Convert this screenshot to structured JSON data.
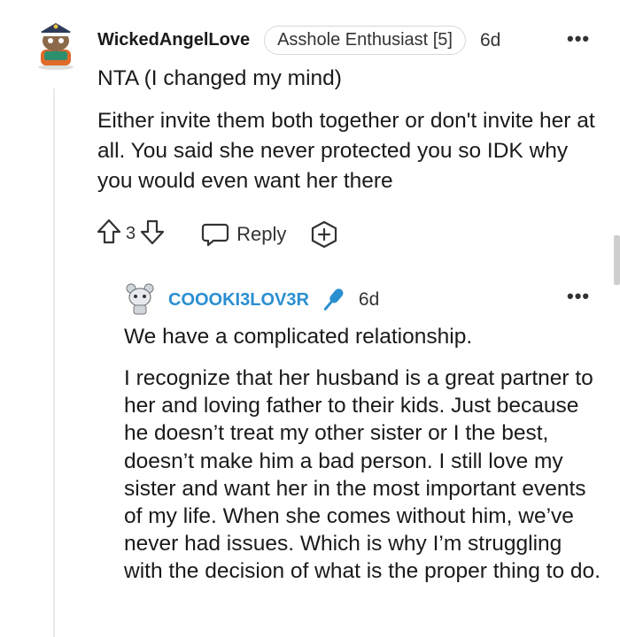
{
  "comment_1": {
    "username": "WickedAngelLove",
    "flair": "Asshole Enthusiast [5]",
    "time": "6d",
    "more": "•••",
    "paragraphs": [
      "NTA (I changed my mind)",
      "Either invite them both together or don't invite her at all. You said she never protected you so IDK why you would even want her there"
    ],
    "votes": "3",
    "reply_label": "Reply"
  },
  "comment_2": {
    "username": "COOOKI3LOV3R",
    "time": "6d",
    "more": "•••",
    "paragraphs": [
      "We have a complicated relationship.",
      "I recognize that her husband is a great partner to her and loving father to their kids. Just because he doesn’t treat my other sister or I the best, doesn’t make him a bad person. I still love my sister and want her in the most important events of my life. When she comes without him, we’ve never had issues. Which is why I’m struggling with the decision of what is the proper thing to do."
    ]
  },
  "icons": {
    "upvote": "upvote-arrow-icon",
    "downvote": "downvote-arrow-icon",
    "reply": "speech-bubble-icon",
    "award": "plus-award-icon",
    "mic": "microphone-icon"
  },
  "colors": {
    "username_blue": "#2a8fd1",
    "mic_blue": "#2a8fd1",
    "text": "#1a1a1b",
    "thread_line": "#e9e9e9"
  }
}
